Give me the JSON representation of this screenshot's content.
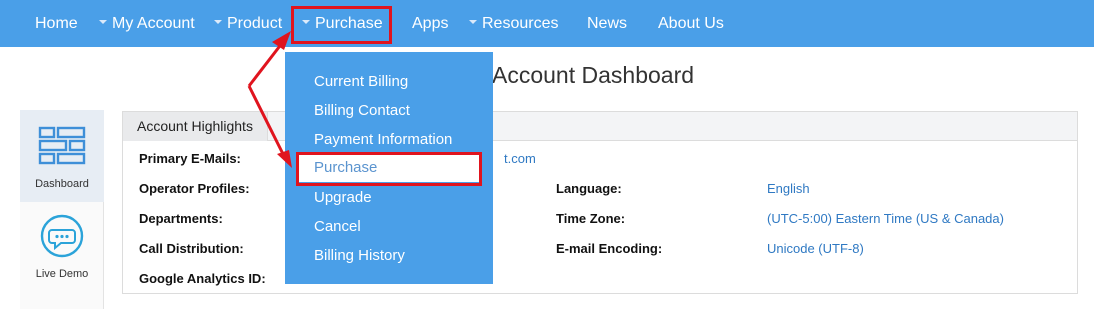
{
  "nav": {
    "home": "Home",
    "my_account": "My Account",
    "product": "Product",
    "purchase": "Purchase",
    "apps": "Apps",
    "resources": "Resources",
    "news": "News",
    "about_us": "About Us"
  },
  "page_title": "Account Dashboard",
  "sidebar": {
    "items": [
      {
        "label": "Dashboard",
        "icon": "dashboard-icon"
      },
      {
        "label": "Live Demo",
        "icon": "chat-bubble-icon"
      }
    ]
  },
  "highlights": {
    "tab": "Account Highlights",
    "rows": [
      {
        "label": "Primary E-Mails:",
        "value": "t.com"
      },
      {
        "label": "Operator Profiles:"
      },
      {
        "label": "Departments:"
      },
      {
        "label": "Call Distribution:"
      },
      {
        "label": "Google Analytics ID:"
      }
    ],
    "right_rows": [
      {
        "label": "Language:",
        "value": "English"
      },
      {
        "label": "Time Zone:",
        "value": "(UTC-5:00) Eastern Time (US & Canada)"
      },
      {
        "label": "E-mail Encoding:",
        "value": "Unicode (UTF-8)"
      }
    ]
  },
  "purchase_menu": {
    "items": [
      "Current Billing",
      "Billing Contact",
      "Payment Information",
      "Purchase",
      "Upgrade",
      "Cancel",
      "Billing History"
    ],
    "selected": "Purchase"
  },
  "colors": {
    "nav_bg": "#4a9fe8",
    "annotation_red": "#e0141e",
    "link": "#2f79c3"
  }
}
